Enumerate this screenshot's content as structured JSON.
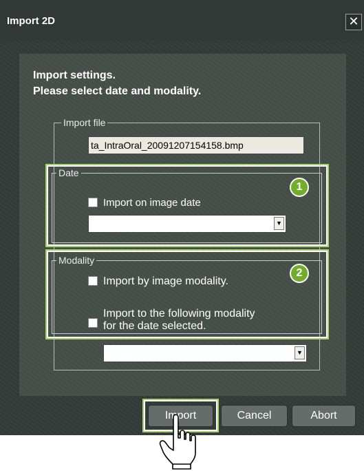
{
  "window": {
    "title": "Import 2D",
    "close_glyph": "✕"
  },
  "instructions": {
    "line1": "Import settings.",
    "line2": "Please select date and modality."
  },
  "import_file": {
    "legend": "Import file",
    "value": "ta_IntraOral_20091207154158.bmp"
  },
  "date_group": {
    "legend": "Date",
    "checkbox_label": "Import on image date",
    "combo_value": "",
    "badge": "1"
  },
  "modality_group": {
    "legend": "Modality",
    "option1_label": "Import by image modality.",
    "option2_line1": "Import to the following modality",
    "option2_line2": "for the date selected.",
    "combo_value": "",
    "badge": "2"
  },
  "buttons": {
    "import": "Import",
    "cancel": "Cancel",
    "abort": "Abort"
  },
  "combo_arrow": "▼",
  "icons": {
    "cursor": "hand-pointer-icon",
    "close": "close-icon",
    "dropdown": "chevron-down-icon"
  },
  "colors": {
    "highlight": "#a7d36c",
    "badge": "#72ad2b",
    "background": "#333a37"
  }
}
